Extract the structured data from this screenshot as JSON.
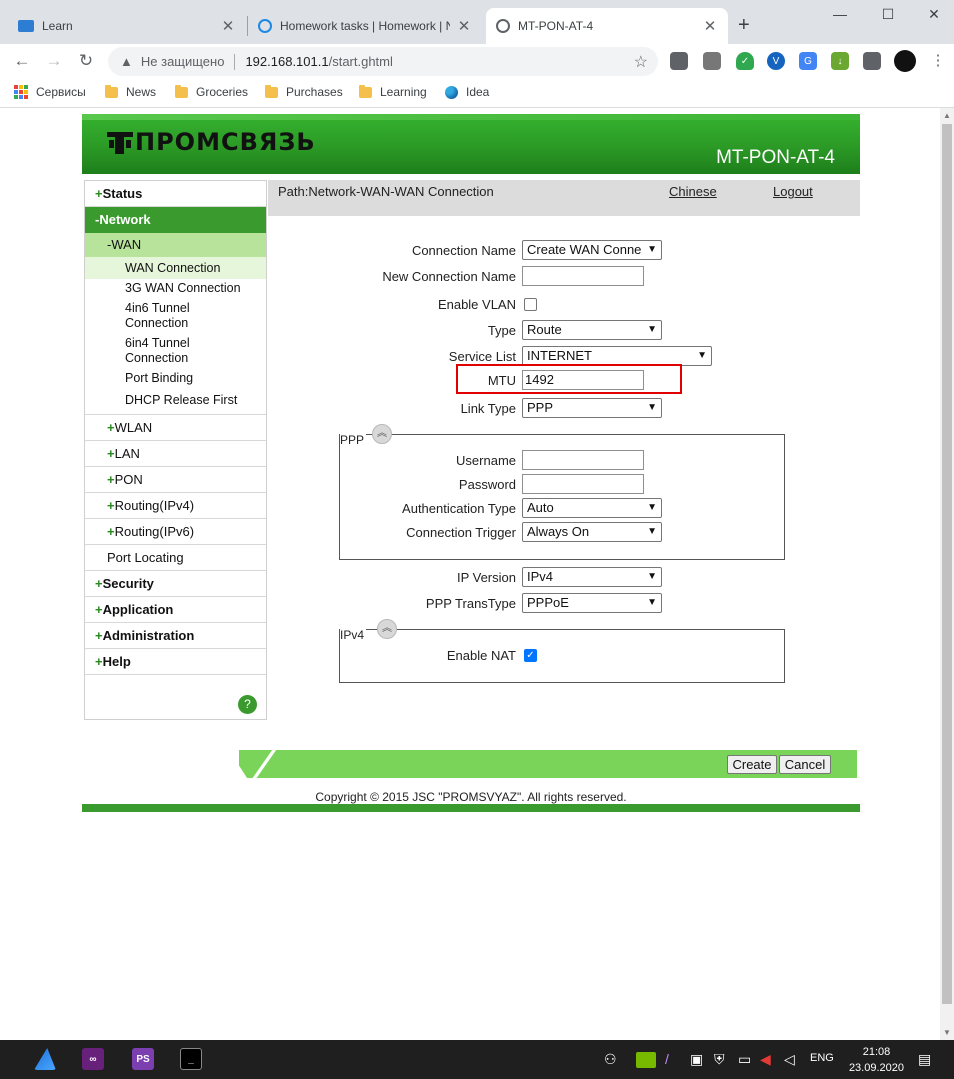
{
  "browser": {
    "tabs": [
      {
        "title": "Learn",
        "icon": "book-icon"
      },
      {
        "title": "Homework tasks | Homework | N",
        "icon": "cortana-icon"
      },
      {
        "title": "MT-PON-AT-4",
        "icon": "globe-icon",
        "active": true
      }
    ],
    "address": {
      "security_label": "Не защищено",
      "host": "192.168.101.1",
      "path": "/start.ghtml"
    },
    "bookmarks": [
      {
        "label": "Сервисы",
        "type": "apps"
      },
      {
        "label": "News",
        "type": "folder"
      },
      {
        "label": "Groceries",
        "type": "folder"
      },
      {
        "label": "Purchases",
        "type": "folder"
      },
      {
        "label": "Learning",
        "type": "folder"
      },
      {
        "label": "Idea",
        "type": "app"
      }
    ]
  },
  "router": {
    "brand": "ПРОМСВЯЗЬ",
    "model": "MT-PON-AT-4",
    "path": "Path:Network-WAN-WAN Connection",
    "links": {
      "chinese": "Chinese",
      "logout": "Logout"
    },
    "menu": {
      "status": "Status",
      "network": "Network",
      "wan": "WAN",
      "wan_items": [
        "WAN Connection",
        "3G WAN Connection",
        "4in6 Tunnel Connection",
        "6in4 Tunnel Connection",
        "Port Binding",
        "DHCP Release First"
      ],
      "network_sub": [
        "WLAN",
        "LAN",
        "PON",
        "Routing(IPv4)",
        "Routing(IPv6)"
      ],
      "port_locating": "Port Locating",
      "security": "Security",
      "application": "Application",
      "administration": "Administration",
      "help": "Help",
      "help_icon": "?"
    },
    "form": {
      "connection_name": {
        "label": "Connection Name",
        "value": "Create WAN Conne"
      },
      "new_connection_name": {
        "label": "New Connection Name",
        "value": ""
      },
      "enable_vlan": {
        "label": "Enable VLAN",
        "checked": false
      },
      "type": {
        "label": "Type",
        "value": "Route"
      },
      "service_list": {
        "label": "Service List",
        "value": "INTERNET"
      },
      "mtu": {
        "label": "MTU",
        "value": "1492"
      },
      "link_type": {
        "label": "Link Type",
        "value": "PPP"
      },
      "ppp": {
        "legend": "PPP",
        "username": {
          "label": "Username",
          "value": ""
        },
        "password": {
          "label": "Password",
          "value": ""
        },
        "auth_type": {
          "label": "Authentication Type",
          "value": "Auto"
        },
        "conn_trigger": {
          "label": "Connection Trigger",
          "value": "Always On"
        }
      },
      "ip_version": {
        "label": "IP Version",
        "value": "IPv4"
      },
      "ppp_transtype": {
        "label": "PPP TransType",
        "value": "PPPoE"
      },
      "ipv4": {
        "legend": "IPv4",
        "enable_nat": {
          "label": "Enable NAT",
          "checked": true
        }
      }
    },
    "buttons": {
      "create": "Create",
      "cancel": "Cancel"
    },
    "copyright": "Copyright © 2015 JSC \"PROMSVYAZ\". All rights reserved."
  },
  "taskbar": {
    "lang": "ENG",
    "time": "21:08",
    "date": "23.09.2020",
    "ps_label": "PS"
  },
  "colors": {
    "brand_green": "#3a9a2d",
    "highlight_red": "#e00000"
  }
}
